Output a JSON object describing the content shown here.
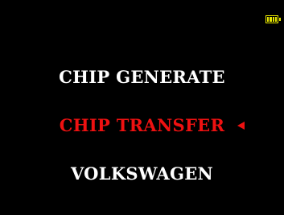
{
  "screen": {
    "background": "#000000"
  },
  "status_bar": {
    "battery": {
      "icon": "battery-icon",
      "level": 1.0,
      "color": "#e6e600"
    }
  },
  "menu": {
    "items": [
      {
        "label": "CHIP GENERATE",
        "selected": false,
        "color": "#ffffff"
      },
      {
        "label": "CHIP TRANSFER",
        "selected": true,
        "color": "#ee1111"
      },
      {
        "label": "VOLKSWAGEN",
        "selected": false,
        "color": "#ffffff"
      }
    ],
    "cursor": {
      "icon": "left-triangle-icon",
      "color": "#ee1111"
    }
  }
}
